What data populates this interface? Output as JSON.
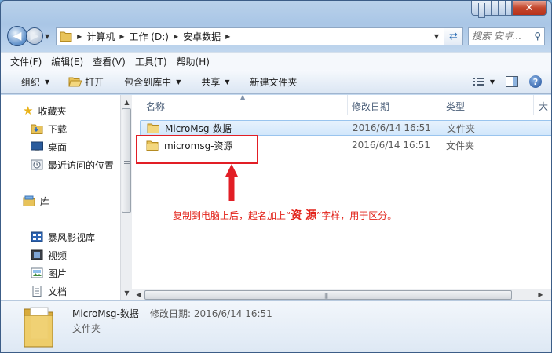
{
  "address": {
    "crumbs": [
      "计算机",
      "工作 (D:)",
      "安卓数据"
    ],
    "search_placeholder": "搜索 安卓..."
  },
  "menubar": [
    "文件(F)",
    "编辑(E)",
    "查看(V)",
    "工具(T)",
    "帮助(H)"
  ],
  "toolbar": {
    "organize": "组织",
    "open": "打开",
    "include": "包含到库中",
    "share": "共享",
    "newfolder": "新建文件夹"
  },
  "nav": {
    "favorites": "收藏夹",
    "downloads": "下载",
    "desktop": "桌面",
    "recent": "最近访问的位置",
    "libraries": "库",
    "storm": "暴风影视库",
    "videos": "视频",
    "pictures": "图片",
    "documents": "文档"
  },
  "columns": {
    "name": "名称",
    "date": "修改日期",
    "type": "类型",
    "size": "大"
  },
  "files": [
    {
      "name": "MicroMsg-数据",
      "date": "2016/6/14 16:51",
      "type": "文件夹"
    },
    {
      "name": "micromsg-资源",
      "date": "2016/6/14 16:51",
      "type": "文件夹"
    }
  ],
  "annotation": {
    "before": "复制到电脑上后，起名加上“",
    "highlight": "资 源",
    "after": "”字样，用于区分。"
  },
  "details": {
    "name": "MicroMsg-数据",
    "meta": "修改日期: 2016/6/14 16:51",
    "type": "文件夹"
  },
  "colors": {
    "annotation": "#e2231a",
    "selection": "#d2e7fb"
  }
}
